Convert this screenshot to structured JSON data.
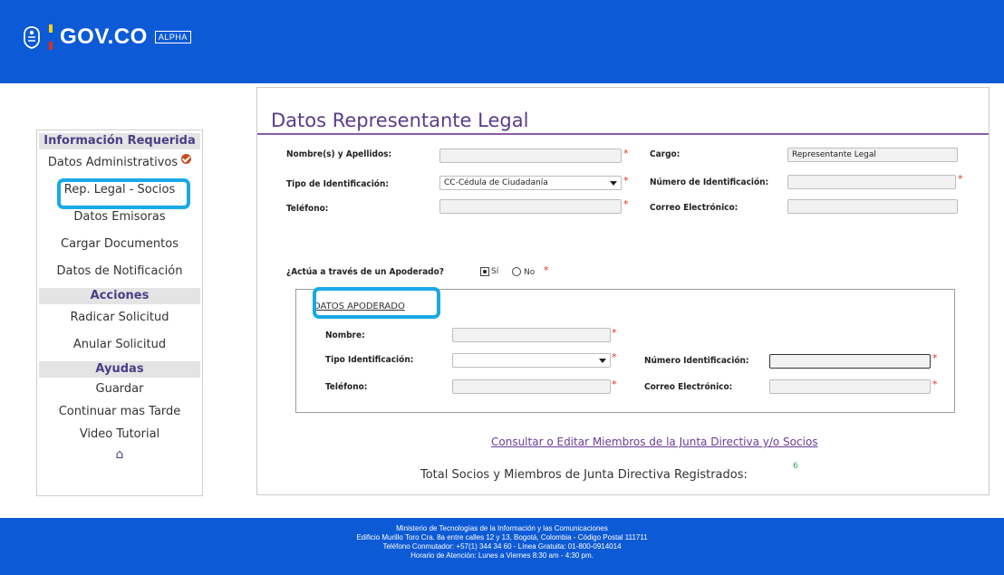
{
  "header": {
    "logo_text": "GOV.CO",
    "badge": "ALPHA"
  },
  "sidebar": {
    "sections": [
      {
        "title": "Información Requerida",
        "items": [
          "Datos Administrativos",
          "Rep. Legal - Socios",
          "Datos Emisoras",
          "Cargar Documentos",
          "Datos de Notificación"
        ]
      },
      {
        "title": "Acciones",
        "items": [
          "Radicar Solicitud",
          "Anular Solicitud"
        ]
      },
      {
        "title": "Ayudas",
        "items": [
          "Guardar",
          "Continuar mas Tarde",
          "Video Tutorial"
        ]
      }
    ]
  },
  "main": {
    "title": "Datos Representante Legal",
    "fields": {
      "nombre_label": "Nombre(s) y Apellidos:",
      "nombre_value": "",
      "cargo_label": "Cargo:",
      "cargo_value": "Representante Legal",
      "tipo_id_label": "Tipo de Identificación:",
      "tipo_id_value": "CC-Cédula de Ciudadanía",
      "numero_id_label": "Número de Identificación:",
      "numero_id_value": "",
      "telefono_label": "Teléfono:",
      "telefono_value": "",
      "correo_label": "Correo Electrónico:",
      "correo_value": ""
    },
    "apoderado_question": "¿Actúa a través de un Apoderado?",
    "apoderado_options": {
      "yes": "Sí",
      "no": "No",
      "selected": "Sí"
    },
    "required_mark": "*",
    "apoderado": {
      "section_title": "DATOS APODERADO",
      "nombre_label": "Nombre:",
      "tipo_id_label": "Tipo Identificación:",
      "numero_id_label": "Número Identificación:",
      "telefono_label": "Teléfono:",
      "correo_label": "Correo Electrónico:"
    },
    "consult_link": "Consultar o Editar Miembros de la Junta Directiva y/o Socios",
    "total_label": "Total Socios y Miembros de Junta Directiva Registrados:",
    "total_count": "6"
  },
  "footer": {
    "lines": [
      "Ministerio de Tecnologías de la Información y las Comunicaciones",
      "Edificio Murillo Toro Cra. 8a entre calles 12 y 13, Bogotá, Colombia - Código Postal 111711",
      "Teléfono Conmutador: +57(1) 344 34 60 - Línea Gratuita: 01-800-0914014",
      "Horario de Atención: Lunes a Viernes 8:30 am - 4:30 pm."
    ]
  },
  "colors": {
    "header_blue": "#0d5ad6",
    "accent_purple": "#5a3c8a",
    "highlight_cyan": "#1aa9e8",
    "required_red": "#e0301e"
  }
}
